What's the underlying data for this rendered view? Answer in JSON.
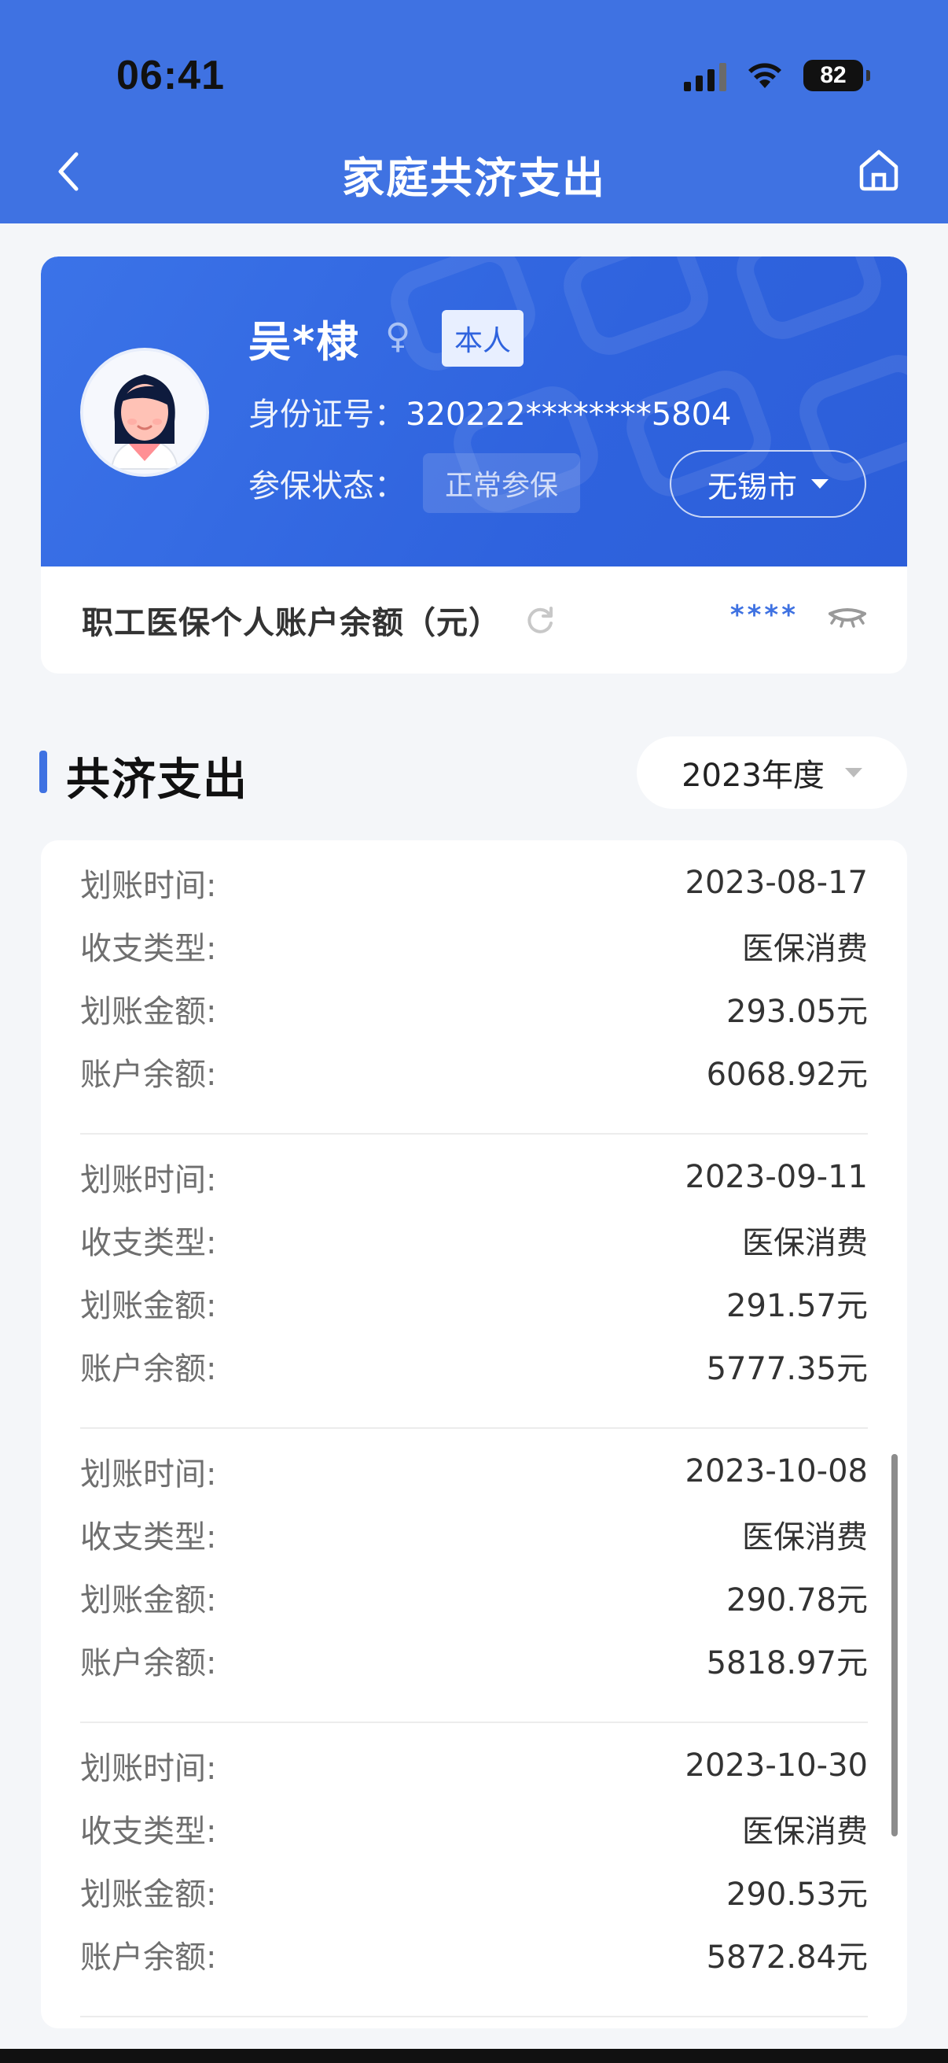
{
  "status_bar": {
    "time": "06:41",
    "battery": "82"
  },
  "nav": {
    "title": "家庭共济支出"
  },
  "profile": {
    "name": "吴*棣",
    "gender_symbol": "♀",
    "relation_badge": "本人",
    "id_label": "身份证号：",
    "id_value": "320222********5804",
    "status_label": "参保状态：",
    "status_value": "正常参保",
    "city": "无锡市"
  },
  "balance": {
    "label": "职工医保个人账户余额（元）",
    "value": "****"
  },
  "section": {
    "title": "共济支出",
    "year_select": "2023年度"
  },
  "labels": {
    "time": "划账时间:",
    "type": "收支类型:",
    "amount": "划账金额:",
    "balance": "账户余额:"
  },
  "records": [
    {
      "time": "2023-08-17",
      "type": "医保消费",
      "amount": "293.05元",
      "balance": "6068.92元"
    },
    {
      "time": "2023-09-11",
      "type": "医保消费",
      "amount": "291.57元",
      "balance": "5777.35元"
    },
    {
      "time": "2023-10-08",
      "type": "医保消费",
      "amount": "290.78元",
      "balance": "5818.97元"
    },
    {
      "time": "2023-10-30",
      "type": "医保消费",
      "amount": "290.53元",
      "balance": "5872.84元"
    }
  ],
  "colors": {
    "primary": "#3f72e2",
    "card": "#2f63de",
    "background": "#f4f6f9"
  }
}
